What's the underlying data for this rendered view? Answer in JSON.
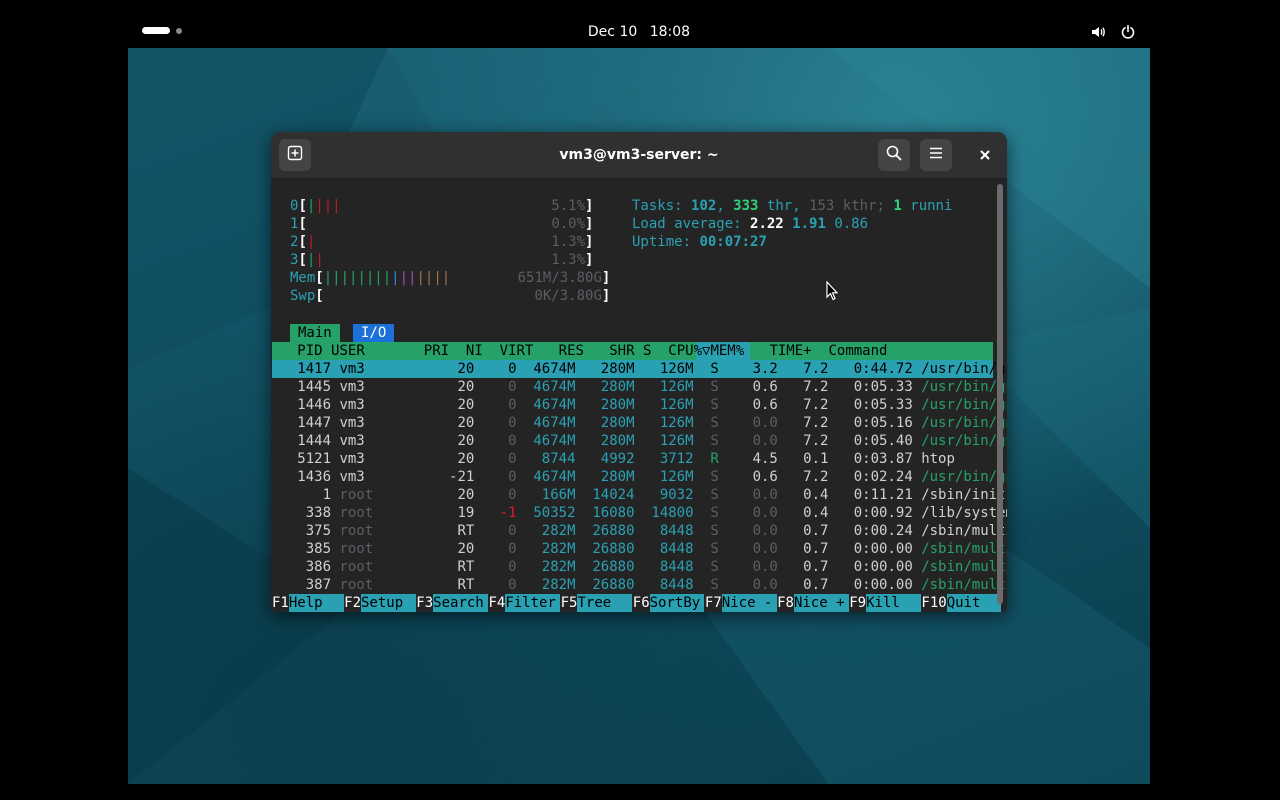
{
  "topbar": {
    "date": "Dec 10",
    "time": "18:08",
    "icons": [
      "workspace-indicator",
      "volume-icon",
      "power-icon"
    ]
  },
  "window": {
    "title": "vm3@vm3-server: ~",
    "icons": [
      "new-tab-icon",
      "search-icon",
      "menu-icon",
      "close-icon"
    ]
  },
  "htop": {
    "meters": {
      "cpu": [
        {
          "label": "0",
          "percent": "5.1%",
          "fraction": 0.051
        },
        {
          "label": "1",
          "percent": "0.0%",
          "fraction": 0.0
        },
        {
          "label": "2",
          "percent": "1.3%",
          "fraction": 0.013
        },
        {
          "label": "3",
          "percent": "1.3%",
          "fraction": 0.013
        }
      ],
      "mem": {
        "label": "Mem",
        "value": "651M/3.80G"
      },
      "swp": {
        "label": "Swp",
        "value": "0K/3.80G"
      }
    },
    "tasks": {
      "label": "Tasks:",
      "tasks": "102",
      "thr": "333",
      "thr_label": "thr,",
      "kthr": "153",
      "kthr_label": "kthr;",
      "running": "1",
      "running_label": "runni"
    },
    "load": {
      "label": "Load average:",
      "one": "2.22",
      "five": "1.91",
      "fifteen": "0.86"
    },
    "uptime": {
      "label": "Uptime:",
      "value": "00:07:27"
    },
    "tabs": [
      "Main",
      "I/O"
    ],
    "columns": [
      "PID",
      "USER",
      "PRI",
      "NI",
      "VIRT",
      "RES",
      "SHR",
      "S",
      "CPU%",
      "MEM%",
      "TIME+",
      "Command"
    ],
    "sort_indicator": "▽",
    "processes": [
      [
        "1417",
        "vm3",
        "20",
        "0",
        "4674M",
        "280M",
        "126M",
        "S",
        "3.2",
        "7.2",
        "0:44.72",
        "/usr/bin/gnom"
      ],
      [
        "1445",
        "vm3",
        "20",
        "0",
        "4674M",
        "280M",
        "126M",
        "S",
        "0.6",
        "7.2",
        "0:05.33",
        "/usr/bin/gnom"
      ],
      [
        "1446",
        "vm3",
        "20",
        "0",
        "4674M",
        "280M",
        "126M",
        "S",
        "0.6",
        "7.2",
        "0:05.33",
        "/usr/bin/gnom"
      ],
      [
        "1447",
        "vm3",
        "20",
        "0",
        "4674M",
        "280M",
        "126M",
        "S",
        "0.0",
        "7.2",
        "0:05.16",
        "/usr/bin/gnom"
      ],
      [
        "1444",
        "vm3",
        "20",
        "0",
        "4674M",
        "280M",
        "126M",
        "S",
        "0.0",
        "7.2",
        "0:05.40",
        "/usr/bin/gnom"
      ],
      [
        "5121",
        "vm3",
        "20",
        "0",
        "8744",
        "4992",
        "3712",
        "R",
        "4.5",
        "0.1",
        "0:03.87",
        "htop"
      ],
      [
        "1436",
        "vm3",
        "-21",
        "0",
        "4674M",
        "280M",
        "126M",
        "S",
        "0.6",
        "7.2",
        "0:02.24",
        "/usr/bin/gnom"
      ],
      [
        "1",
        "root",
        "20",
        "0",
        "166M",
        "14024",
        "9032",
        "S",
        "0.0",
        "0.4",
        "0:11.21",
        "/sbin/init"
      ],
      [
        "338",
        "root",
        "19",
        "-1",
        "50352",
        "16080",
        "14800",
        "S",
        "0.0",
        "0.4",
        "0:00.92",
        "/lib/systemd/"
      ],
      [
        "375",
        "root",
        "RT",
        "0",
        "282M",
        "26880",
        "8448",
        "S",
        "0.0",
        "0.7",
        "0:00.24",
        "/sbin/multipa"
      ],
      [
        "385",
        "root",
        "20",
        "0",
        "282M",
        "26880",
        "8448",
        "S",
        "0.0",
        "0.7",
        "0:00.00",
        "/sbin/multipa"
      ],
      [
        "386",
        "root",
        "RT",
        "0",
        "282M",
        "26880",
        "8448",
        "S",
        "0.0",
        "0.7",
        "0:00.00",
        "/sbin/multipa"
      ],
      [
        "387",
        "root",
        "RT",
        "0",
        "282M",
        "26880",
        "8448",
        "S",
        "0.0",
        "0.7",
        "0:00.00",
        "/sbin/multipa"
      ]
    ],
    "function_keys": [
      {
        "key": "F1",
        "label": "Help"
      },
      {
        "key": "F2",
        "label": "Setup"
      },
      {
        "key": "F3",
        "label": "Search"
      },
      {
        "key": "F4",
        "label": "Filter"
      },
      {
        "key": "F5",
        "label": "Tree"
      },
      {
        "key": "F6",
        "label": "SortBy"
      },
      {
        "key": "F7",
        "label": "Nice -"
      },
      {
        "key": "F8",
        "label": "Nice +"
      },
      {
        "key": "F9",
        "label": "Kill"
      },
      {
        "key": "F10",
        "label": "Quit"
      }
    ]
  },
  "colors": {
    "accent_cyan": "#2aa1b3",
    "header_green": "#26a269",
    "desktop_teal": "#1a5f73"
  }
}
